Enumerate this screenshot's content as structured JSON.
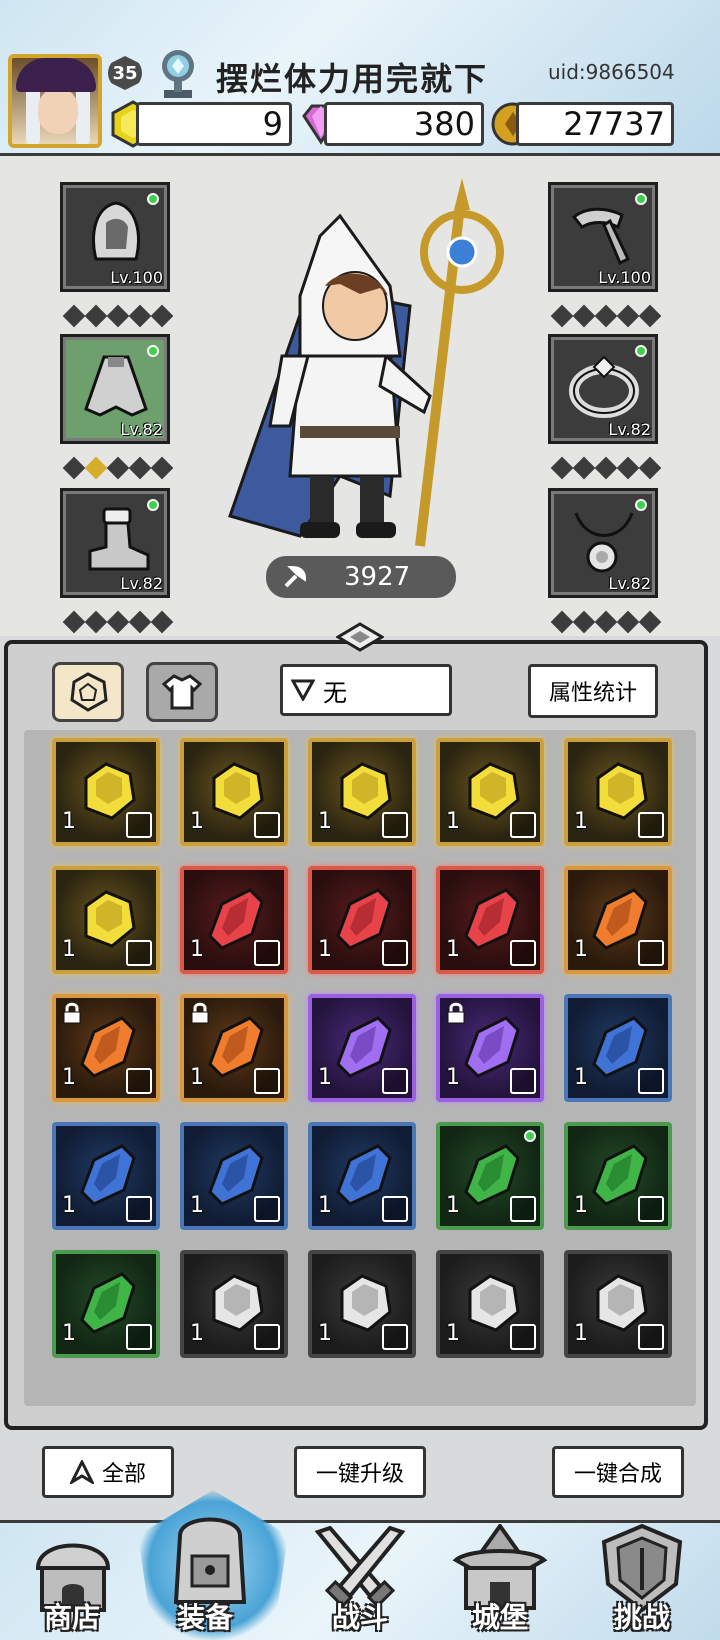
{
  "player": {
    "level": "35",
    "name": "摆烂体力用完就下",
    "uid": "uid:9866504"
  },
  "resources": {
    "stamina": "9",
    "gems": "380",
    "gold": "27737"
  },
  "equipment": {
    "left": [
      {
        "name": "hood",
        "level": "Lv.100"
      },
      {
        "name": "cloak",
        "level": "Lv.82"
      },
      {
        "name": "boots",
        "level": "Lv.82"
      }
    ],
    "right": [
      {
        "name": "staff",
        "level": "Lv.100"
      },
      {
        "name": "ring",
        "level": "Lv.82"
      },
      {
        "name": "amulet",
        "level": "Lv.82"
      }
    ]
  },
  "combat_power": "3927",
  "filter": {
    "label": "无",
    "stats_button": "属性统计"
  },
  "inventory": {
    "items": [
      {
        "quality": "gold",
        "qty": "1"
      },
      {
        "quality": "gold",
        "qty": "1"
      },
      {
        "quality": "gold",
        "qty": "1"
      },
      {
        "quality": "gold",
        "qty": "1"
      },
      {
        "quality": "gold",
        "qty": "1"
      },
      {
        "quality": "gold",
        "qty": "1"
      },
      {
        "quality": "red",
        "qty": "1"
      },
      {
        "quality": "red",
        "qty": "1"
      },
      {
        "quality": "red",
        "qty": "1"
      },
      {
        "quality": "orange",
        "qty": "1"
      },
      {
        "quality": "orange",
        "qty": "1"
      },
      {
        "quality": "orange",
        "qty": "1"
      },
      {
        "quality": "purple",
        "qty": "1"
      },
      {
        "quality": "purple",
        "qty": "1"
      },
      {
        "quality": "blue",
        "qty": "1"
      },
      {
        "quality": "blue",
        "qty": "1"
      },
      {
        "quality": "blue",
        "qty": "1"
      },
      {
        "quality": "blue",
        "qty": "1"
      },
      {
        "quality": "green",
        "qty": "1"
      },
      {
        "quality": "green",
        "qty": "1"
      },
      {
        "quality": "green",
        "qty": "1"
      },
      {
        "quality": "gray",
        "qty": "1"
      },
      {
        "quality": "gray",
        "qty": "1"
      },
      {
        "quality": "gray",
        "qty": "1"
      },
      {
        "quality": "gray",
        "qty": "1"
      }
    ]
  },
  "actions": {
    "all": "全部",
    "upgrade_all": "一键升级",
    "merge_all": "一键合成"
  },
  "nav": {
    "shop": "商店",
    "equipment": "装备",
    "battle": "战斗",
    "castle": "城堡",
    "challenge": "挑战"
  },
  "colors": {
    "gold": "#c9a03b",
    "red": "#d75a4a",
    "orange": "#d79840",
    "purple": "#9a62e0",
    "blue": "#4b77b8",
    "green": "#4c9a50",
    "gray": "#444444"
  }
}
